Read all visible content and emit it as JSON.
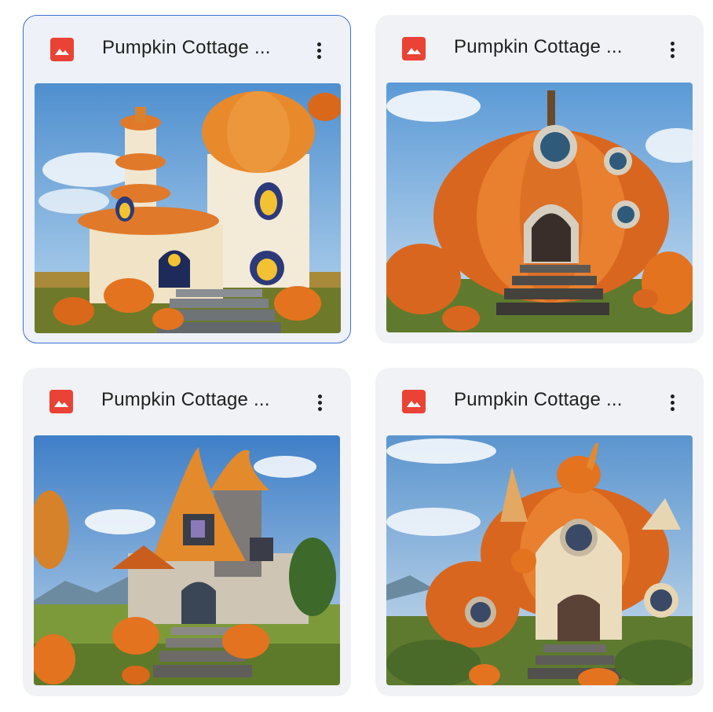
{
  "files": [
    {
      "title": "Pumpkin Cottage ...",
      "selected": true,
      "icon": "image-file-icon",
      "thumbnail": "pumpkin-cottage-tower"
    },
    {
      "title": "Pumpkin Cottage ...",
      "selected": false,
      "icon": "image-file-icon",
      "thumbnail": "pumpkin-house-stone-trim"
    },
    {
      "title": "Pumpkin Cottage ...",
      "selected": false,
      "icon": "image-file-icon",
      "thumbnail": "pumpkin-roof-cottage-hills"
    },
    {
      "title": "Pumpkin Cottage ...",
      "selected": false,
      "icon": "image-file-icon",
      "thumbnail": "pumpkin-house-round-windows"
    }
  ],
  "colors": {
    "accent": "#3d6fd6",
    "file_icon": "#ea4335",
    "card_bg": "#f0f2f6"
  }
}
